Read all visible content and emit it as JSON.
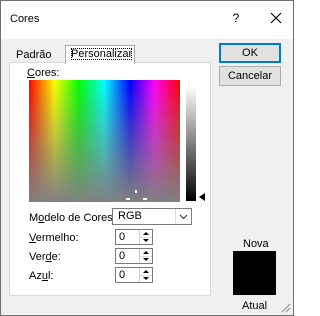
{
  "window": {
    "title": "Cores",
    "help_label": "?"
  },
  "tabs": [
    {
      "label": "Padrão"
    },
    {
      "label": "Personalizar"
    }
  ],
  "colors_label": {
    "key": "C",
    "rest": "ores:"
  },
  "model": {
    "label_key": "o",
    "label_pre": "M",
    "label_rest": "delo de Cores:",
    "value": "RGB"
  },
  "channels": [
    {
      "pre": "",
      "key": "V",
      "rest": "ermelho:",
      "value": "0"
    },
    {
      "pre": "Ver",
      "key": "d",
      "rest": "e:",
      "value": "0"
    },
    {
      "pre": "Az",
      "key": "u",
      "rest": "l:",
      "value": "0"
    }
  ],
  "buttons": {
    "ok": "OK",
    "cancel": "Cancelar"
  },
  "preview": {
    "new_label": "Nova",
    "current_label": "Atual",
    "color": "#000000"
  }
}
